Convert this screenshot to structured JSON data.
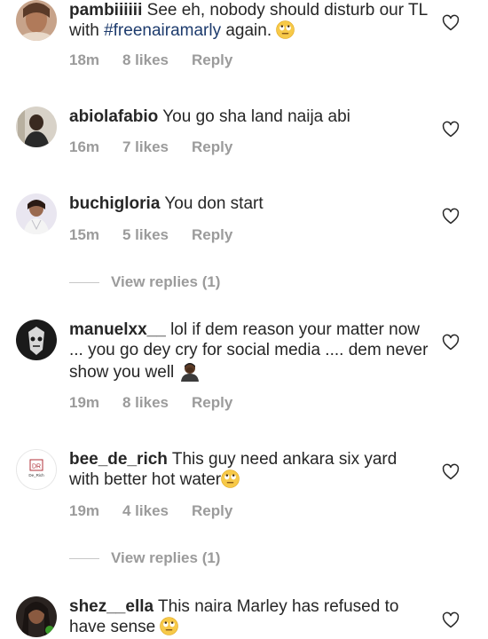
{
  "comments": [
    {
      "username": "pambiiiiii",
      "text_before": "See eh, nobody should disturb our TL with ",
      "hashtag": "#freenairamarly",
      "text_after": " again.",
      "time": "18m",
      "likes": "8 likes",
      "reply": "Reply"
    },
    {
      "username": "abiolafabio",
      "text": "You go sha land naija abi",
      "time": "16m",
      "likes": "7 likes",
      "reply": "Reply"
    },
    {
      "username": "buchigloria",
      "text": "You don start",
      "time": "15m",
      "likes": "5 likes",
      "reply": "Reply",
      "view_replies": "View replies (1)"
    },
    {
      "username": "manuelxx__",
      "text": "lol if dem reason your matter now ... you go dey cry for social media .... dem never show you well",
      "time": "19m",
      "likes": "8 likes",
      "reply": "Reply"
    },
    {
      "username": "bee_de_rich",
      "text": "This guy need ankara  six yard with better hot water",
      "time": "19m",
      "likes": "4 likes",
      "reply": "Reply",
      "view_replies": "View replies (1)",
      "avatar_logo": "DR",
      "avatar_caption": "De_Rich"
    },
    {
      "username": "shez__ella",
      "text": "This naira Marley has refused to have sense"
    }
  ],
  "icons": {
    "like": "heart-icon",
    "eye_roll": "face-with-rolling-eyes-emoji",
    "person": "person-emoji"
  },
  "colors": {
    "text": "#262626",
    "meta": "#9b9b9b",
    "hashtag": "#1d3b6d"
  }
}
